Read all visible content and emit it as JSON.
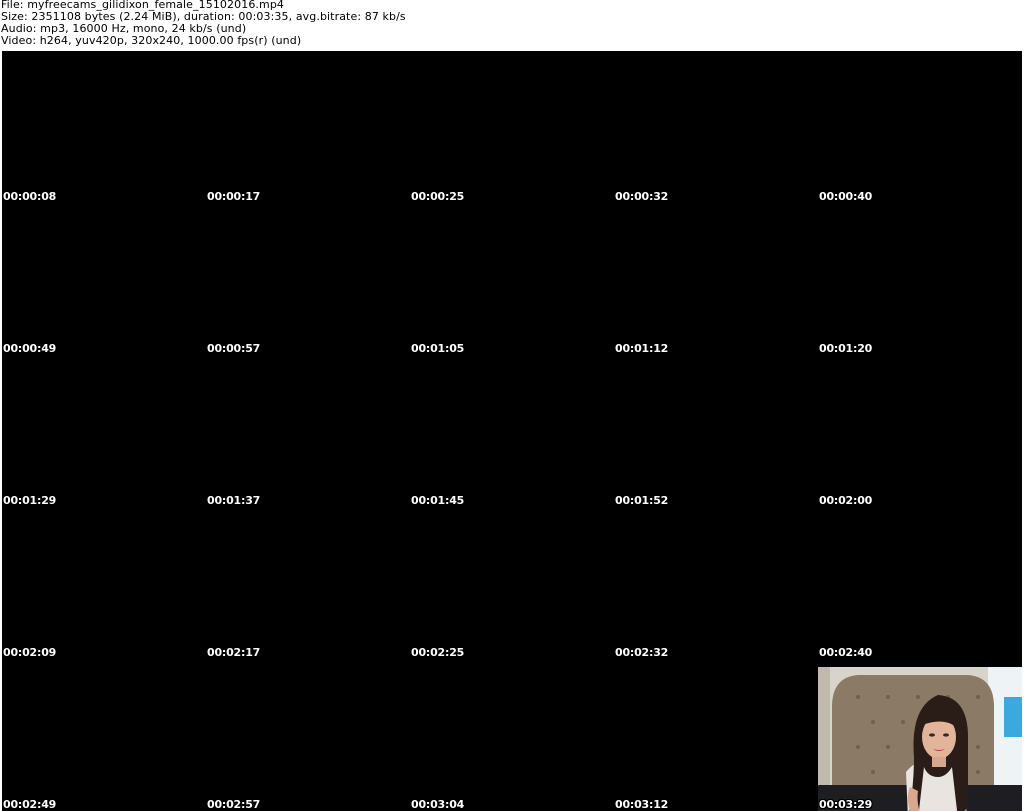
{
  "header": {
    "file_line": "File: myfreecams_gilidixon_female_15102016.mp4",
    "size_line": "Size: 2351108 bytes (2.24 MiB), duration: 00:03:35, avg.bitrate: 87 kb/s",
    "audio_line": "Audio: mp3, 16000 Hz, mono, 24 kb/s (und)",
    "video_line": "Video: h264, yuv420p, 320x240, 1000.00 fps(r) (und)"
  },
  "thumbnails": [
    {
      "timestamp": "00:00:08",
      "content": "black-frame"
    },
    {
      "timestamp": "00:00:17",
      "content": "black-frame"
    },
    {
      "timestamp": "00:00:25",
      "content": "black-frame"
    },
    {
      "timestamp": "00:00:32",
      "content": "black-frame"
    },
    {
      "timestamp": "00:00:40",
      "content": "black-frame"
    },
    {
      "timestamp": "00:00:49",
      "content": "black-frame"
    },
    {
      "timestamp": "00:00:57",
      "content": "black-frame"
    },
    {
      "timestamp": "00:01:05",
      "content": "black-frame"
    },
    {
      "timestamp": "00:01:12",
      "content": "black-frame"
    },
    {
      "timestamp": "00:01:20",
      "content": "black-frame"
    },
    {
      "timestamp": "00:01:29",
      "content": "black-frame"
    },
    {
      "timestamp": "00:01:37",
      "content": "black-frame"
    },
    {
      "timestamp": "00:01:45",
      "content": "black-frame"
    },
    {
      "timestamp": "00:01:52",
      "content": "black-frame"
    },
    {
      "timestamp": "00:02:00",
      "content": "black-frame"
    },
    {
      "timestamp": "00:02:09",
      "content": "black-frame"
    },
    {
      "timestamp": "00:02:17",
      "content": "black-frame"
    },
    {
      "timestamp": "00:02:25",
      "content": "black-frame"
    },
    {
      "timestamp": "00:02:32",
      "content": "black-frame"
    },
    {
      "timestamp": "00:02:40",
      "content": "black-frame"
    },
    {
      "timestamp": "00:02:49",
      "content": "black-frame"
    },
    {
      "timestamp": "00:02:57",
      "content": "black-frame"
    },
    {
      "timestamp": "00:03:04",
      "content": "black-frame"
    },
    {
      "timestamp": "00:03:12",
      "content": "black-frame"
    },
    {
      "timestamp": "00:03:29",
      "content": "webcam-frame"
    }
  ],
  "colors": {
    "background": "#ffffff",
    "frame": "#000000",
    "timestamp_text": "#ffffff"
  }
}
